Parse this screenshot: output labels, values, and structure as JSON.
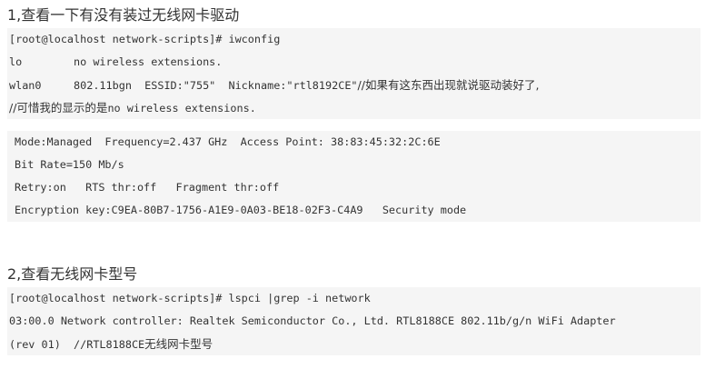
{
  "section1": {
    "heading": "1,查看一下有没有装过无线网卡驱动",
    "block1": {
      "line1": "[root@localhost network-scripts]# iwconfig",
      "line2": "lo        no wireless extensions.",
      "line3_code": "wlan0     802.11bgn  ESSID:\"755\"  Nickname:\"rtl8192CE\"",
      "line3_comment": "//如果有这东西出现就说驱动装好了,",
      "line4_prefix": "//可惜我的显示的是",
      "line4_code": "no wireless extensions."
    },
    "block2": {
      "line1": "Mode:Managed  Frequency=2.437 GHz  Access Point: 38:83:45:32:2C:6E",
      "line2": "Bit Rate=150 Mb/s",
      "line3": "Retry:on   RTS thr:off   Fragment thr:off",
      "line4": "Encryption key:C9EA-80B7-1756-A1E9-0A03-BE18-02F3-C4A9   Security mode"
    }
  },
  "section2": {
    "heading": "2,查看无线网卡型号",
    "block": {
      "line1": "[root@localhost network-scripts]# lspci |grep -i network",
      "line2": "03:00.0 Network controller: Realtek Semiconductor Co., Ltd. RTL8188CE 802.11b/g/n WiFi Adapter",
      "line3_code": "(rev 01)  //RTL8188CE",
      "line3_comment": "无线网卡型号"
    }
  }
}
